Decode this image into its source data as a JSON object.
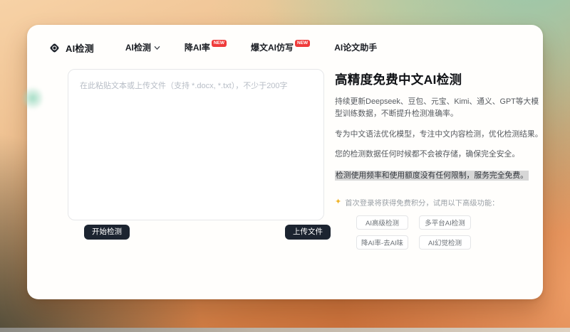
{
  "brand": {
    "name": "AI检测"
  },
  "nav": {
    "items": [
      {
        "label": "AI检测"
      },
      {
        "label": "降AI率",
        "badge": "NEW"
      },
      {
        "label": "爆文AI仿写",
        "badge": "NEW"
      },
      {
        "label": "AI论文助手"
      }
    ]
  },
  "editor": {
    "placeholder": "在此粘贴文本或上传文件（支持 *.docx, *.txt），不少于200字",
    "start_button": "开始检测",
    "upload_button": "上传文件"
  },
  "intro": {
    "title": "高精度免费中文AI检测",
    "p1": "持续更新Deepseek、豆包、元宝、Kimi、通义、GPT等大模型训练数据，不断提升检测准确率。",
    "p2": "专为中文语法优化模型，专注中文内容检测，优化检测结果。",
    "p3": "您的检测数据任何时候都不会被存储，确保完全安全。",
    "highlight": "检测使用频率和使用额度没有任何限制，服务完全免费。",
    "promo_icon": "✦",
    "promo": "首次登录将获得免费积分，试用以下高级功能：",
    "features": [
      "AI高级检测",
      "多平台AI检测",
      "降AI率-去AI味",
      "AI幻觉检测"
    ]
  },
  "colors": {
    "badge": "#ef3b3b",
    "dark_button": "#1c2430",
    "highlight_bg": "#d7d7d7",
    "sparkle": "#f0b429"
  }
}
